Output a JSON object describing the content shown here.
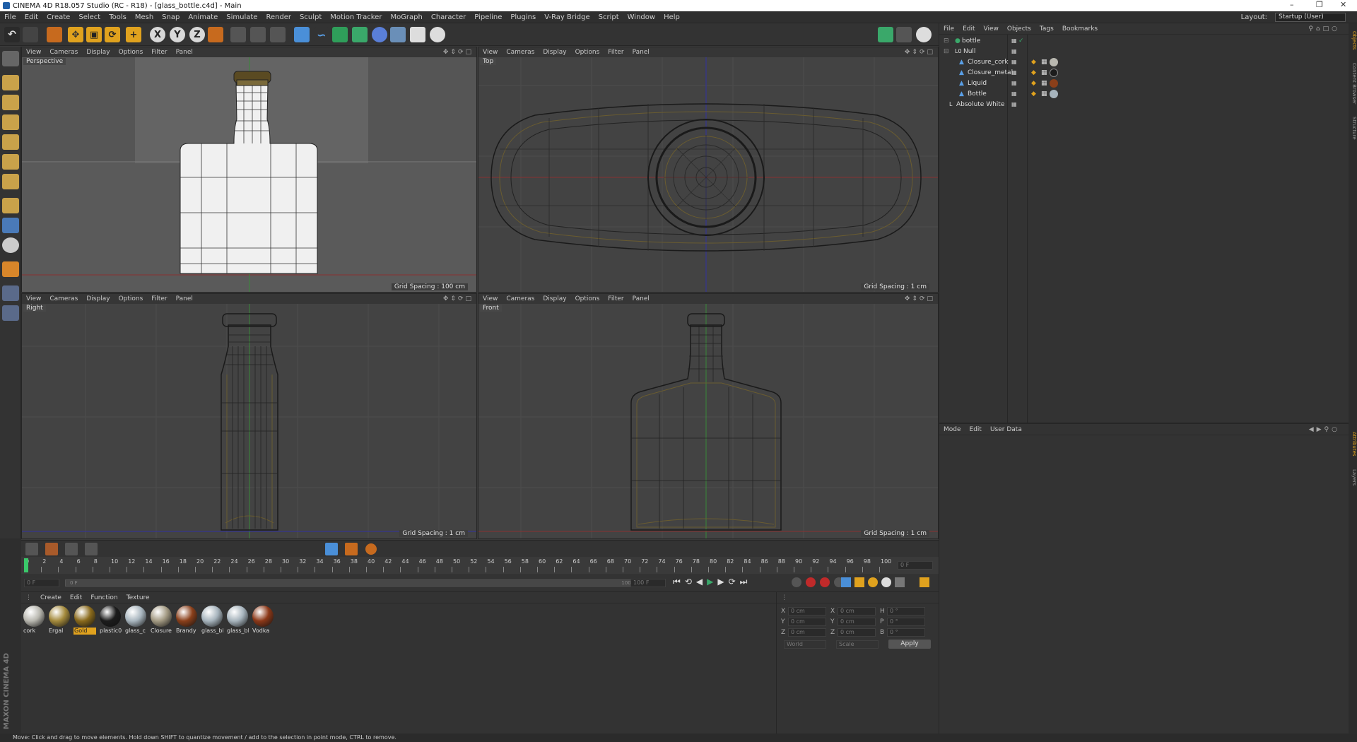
{
  "window": {
    "title": "CINEMA 4D R18.057 Studio (RC - R18) - [glass_bottle.c4d] - Main"
  },
  "menu": [
    "File",
    "Edit",
    "Create",
    "Select",
    "Tools",
    "Mesh",
    "Snap",
    "Animate",
    "Simulate",
    "Render",
    "Sculpt",
    "Motion Tracker",
    "MoGraph",
    "Character",
    "Pipeline",
    "Plugins",
    "V-Ray Bridge",
    "Script",
    "Window",
    "Help"
  ],
  "layout": {
    "label": "Layout:",
    "value": "Startup (User)"
  },
  "toolbar": {
    "x_axis": "X",
    "y_axis": "Y",
    "z_axis": "Z"
  },
  "viewports": {
    "menu": [
      "View",
      "Cameras",
      "Display",
      "Options",
      "Filter",
      "Panel"
    ],
    "perspective": {
      "name": "Perspective",
      "grid": "Grid Spacing : 100 cm"
    },
    "top": {
      "name": "Top",
      "grid": "Grid Spacing : 1 cm"
    },
    "right": {
      "name": "Right",
      "grid": "Grid Spacing : 1 cm"
    },
    "front": {
      "name": "Front",
      "grid": "Grid Spacing : 1 cm"
    }
  },
  "object_manager": {
    "menu": [
      "File",
      "Edit",
      "View",
      "Objects",
      "Tags",
      "Bookmarks"
    ],
    "objects": [
      {
        "name": "bottle"
      },
      {
        "name": "Null"
      },
      {
        "name": "Closure_cork"
      },
      {
        "name": "Closure_metal"
      },
      {
        "name": "Liquid"
      },
      {
        "name": "Bottle"
      },
      {
        "name": "Absolute White"
      }
    ]
  },
  "attribute_manager": {
    "menu": [
      "Mode",
      "Edit",
      "User Data"
    ]
  },
  "timeline": {
    "ticks": [
      "0",
      "2",
      "4",
      "6",
      "8",
      "10",
      "12",
      "14",
      "16",
      "18",
      "20",
      "22",
      "24",
      "26",
      "28",
      "30",
      "32",
      "34",
      "36",
      "38",
      "40",
      "42",
      "44",
      "46",
      "48",
      "50",
      "52",
      "54",
      "56",
      "58",
      "60",
      "62",
      "64",
      "66",
      "68",
      "70",
      "72",
      "74",
      "76",
      "78",
      "80",
      "82",
      "84",
      "86",
      "88",
      "90",
      "92",
      "94",
      "96",
      "98",
      "100"
    ],
    "current_frame": "0 F",
    "start_frame": "0 F",
    "range_start": "0 F",
    "range_end": "100 F",
    "end_frame": "100 F"
  },
  "material_manager": {
    "menu": [
      "Create",
      "Edit",
      "Function",
      "Texture"
    ],
    "materials": [
      {
        "name": "cork",
        "color": "#b9b8b0"
      },
      {
        "name": "Ergal",
        "color": "#a48a3c"
      },
      {
        "name": "Gold",
        "color": "#8a6a1c"
      },
      {
        "name": "plastic0",
        "color": "#1c1c1c"
      },
      {
        "name": "glass_c",
        "color": "#a9b6bf"
      },
      {
        "name": "Closure",
        "color": "#a39a83"
      },
      {
        "name": "Brandy",
        "color": "#8a3f1a"
      },
      {
        "name": "glass_bl",
        "color": "#a7b4bd"
      },
      {
        "name": "glass_bl",
        "color": "#a7b4bd"
      },
      {
        "name": "Vodka",
        "color": "#8c3818"
      }
    ]
  },
  "coordinates": {
    "pos_x": "0 cm",
    "pos_y": "0 cm",
    "pos_z": "0 cm",
    "size_x": "0 cm",
    "size_y": "0 cm",
    "size_z": "0 cm",
    "rot_h": "0 °",
    "rot_p": "0 °",
    "rot_b": "0 °",
    "labels": {
      "x": "X",
      "y": "Y",
      "z": "Z",
      "h": "H",
      "p": "P",
      "b": "B"
    },
    "mode1": "World",
    "mode2": "Scale",
    "apply": "Apply"
  },
  "statusbar": {
    "text": "Move: Click and drag to move elements. Hold down SHIFT to quantize movement / add to the selection in point mode, CTRL to remove."
  },
  "branding": "MAXON CINEMA 4D",
  "side_tabs": [
    "Objects",
    "Content Browser",
    "Structure",
    "Attributes",
    "Layers"
  ]
}
